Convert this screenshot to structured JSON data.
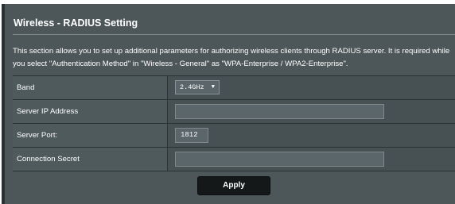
{
  "section": {
    "title": "Wireless - RADIUS Setting",
    "description_line1": "This section allows you to set up additional parameters for authorizing wireless clients through RADIUS server. It is required while",
    "description_line2": "you select \"Authentication Method\" in \"Wireless - General\" as \"WPA-Enterprise / WPA2-Enterprise\"."
  },
  "form": {
    "band": {
      "label": "Band",
      "selected": "2.4GHz",
      "dropdown_icon": "chevron-down-icon"
    },
    "server_ip": {
      "label": "Server IP Address",
      "value": ""
    },
    "server_port": {
      "label": "Server Port:",
      "value": "1812"
    },
    "connection_secret": {
      "label": "Connection Secret",
      "value": ""
    }
  },
  "actions": {
    "apply_label": "Apply"
  },
  "colors": {
    "panel_bg": "#4d5659",
    "label_cell_bg": "#4f5a5d",
    "value_cell_bg": "#475053",
    "button_bg": "#141819",
    "text": "#ffffff"
  }
}
